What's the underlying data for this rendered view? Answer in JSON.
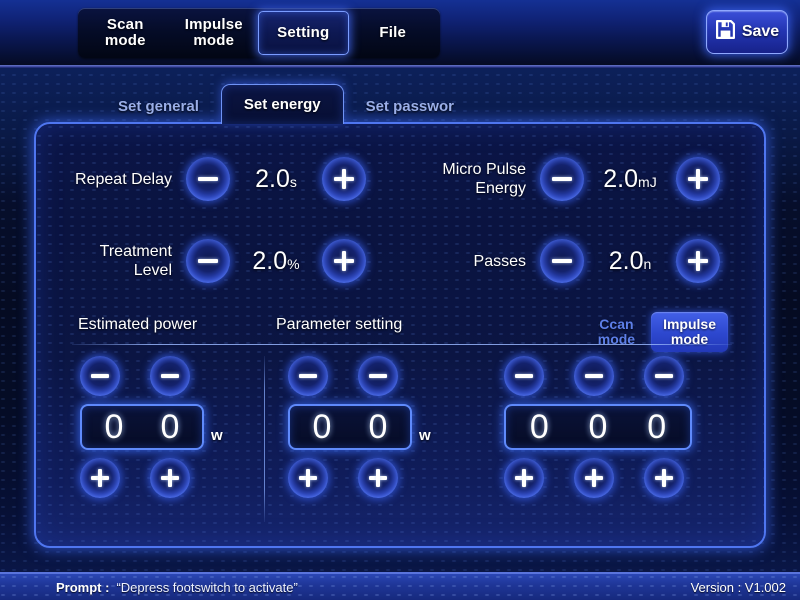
{
  "header": {
    "tabs": [
      {
        "label": "Scan\nmode",
        "active": false
      },
      {
        "label": "Impulse\nmode",
        "active": false
      },
      {
        "label": "Setting",
        "active": true
      },
      {
        "label": "File",
        "active": false
      }
    ],
    "save_label": "Save",
    "save_icon": "floppy-disk-icon"
  },
  "subtabs": [
    {
      "label": "Set general",
      "active": false
    },
    {
      "label": "Set energy",
      "active": true
    },
    {
      "label": "Set passwor",
      "active": false
    }
  ],
  "parameters": [
    {
      "label": "Repeat Delay",
      "value": "2.0",
      "unit": "s",
      "decrement": "−",
      "increment": "+"
    },
    {
      "label": "Micro Pulse\nEnergy",
      "value": "2.0",
      "unit": "mJ",
      "decrement": "−",
      "increment": "+"
    },
    {
      "label": "Treatment\nLevel",
      "value": "2.0",
      "unit": "%",
      "decrement": "−",
      "increment": "+"
    },
    {
      "label": "Passes",
      "value": "2.0",
      "unit": "n",
      "decrement": "−",
      "increment": "+"
    }
  ],
  "section": {
    "estimated_power_label": "Estimated power",
    "parameter_setting_label": "Parameter setting",
    "modes": [
      {
        "label": "Ccan\nmode",
        "active": false
      },
      {
        "label": "Impulse\nmode",
        "active": true
      }
    ]
  },
  "groups": [
    {
      "digits": [
        "0",
        "0"
      ],
      "unit": "w"
    },
    {
      "digits": [
        "0",
        "0"
      ],
      "unit": "w"
    },
    {
      "digits": [
        "0",
        "0",
        "0"
      ],
      "unit": ""
    }
  ],
  "footer": {
    "prompt_key": "Prompt :",
    "prompt_value": "“Depress footswitch to activate”",
    "version": "Version : V1.002"
  },
  "colors": {
    "accent": "#4f76f0",
    "active_fill": "#2d47ce",
    "panel_bg": "#0b1547",
    "footer_bg": "#1f3698",
    "text": "#ffffff",
    "muted_text": "#5d7fe8"
  }
}
